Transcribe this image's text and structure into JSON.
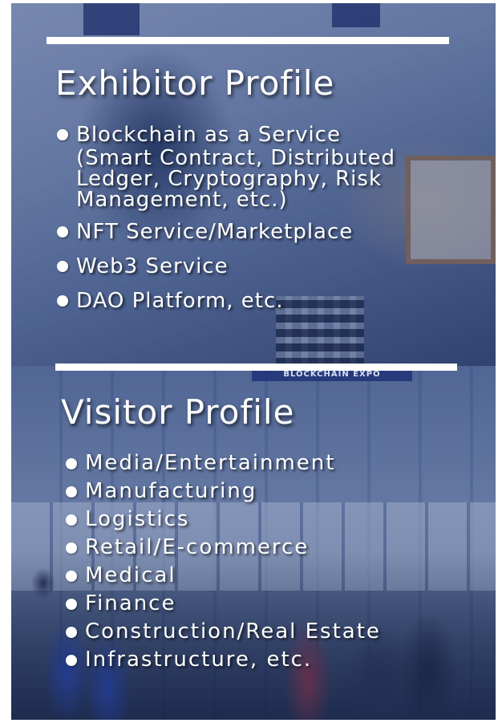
{
  "exhibitor": {
    "title": "Exhibitor Profile",
    "items": [
      {
        "lines": [
          "Blockchain as a Service",
          "(Smart Contract, Distributed",
          "Ledger, Cryptography, Risk",
          "Management, etc.)"
        ]
      },
      {
        "lines": [
          "NFT Service/Marketplace"
        ]
      },
      {
        "lines": [
          "Web3 Service"
        ]
      },
      {
        "lines": [
          "DAO Platform, etc."
        ]
      }
    ]
  },
  "visitor": {
    "title": "Visitor Profile",
    "items": [
      "Media/Entertainment",
      "Manufacturing",
      "Logistics",
      "Retail/E-commerce",
      "Medical",
      "Finance",
      "Construction/Real Estate",
      "Infrastructure, etc."
    ]
  },
  "background": {
    "sign_text": "BLOCKCHAIN EXPO"
  },
  "colors": {
    "text": "#ffffff",
    "rule": "#ffffff",
    "overlay": "#1e3c82"
  }
}
